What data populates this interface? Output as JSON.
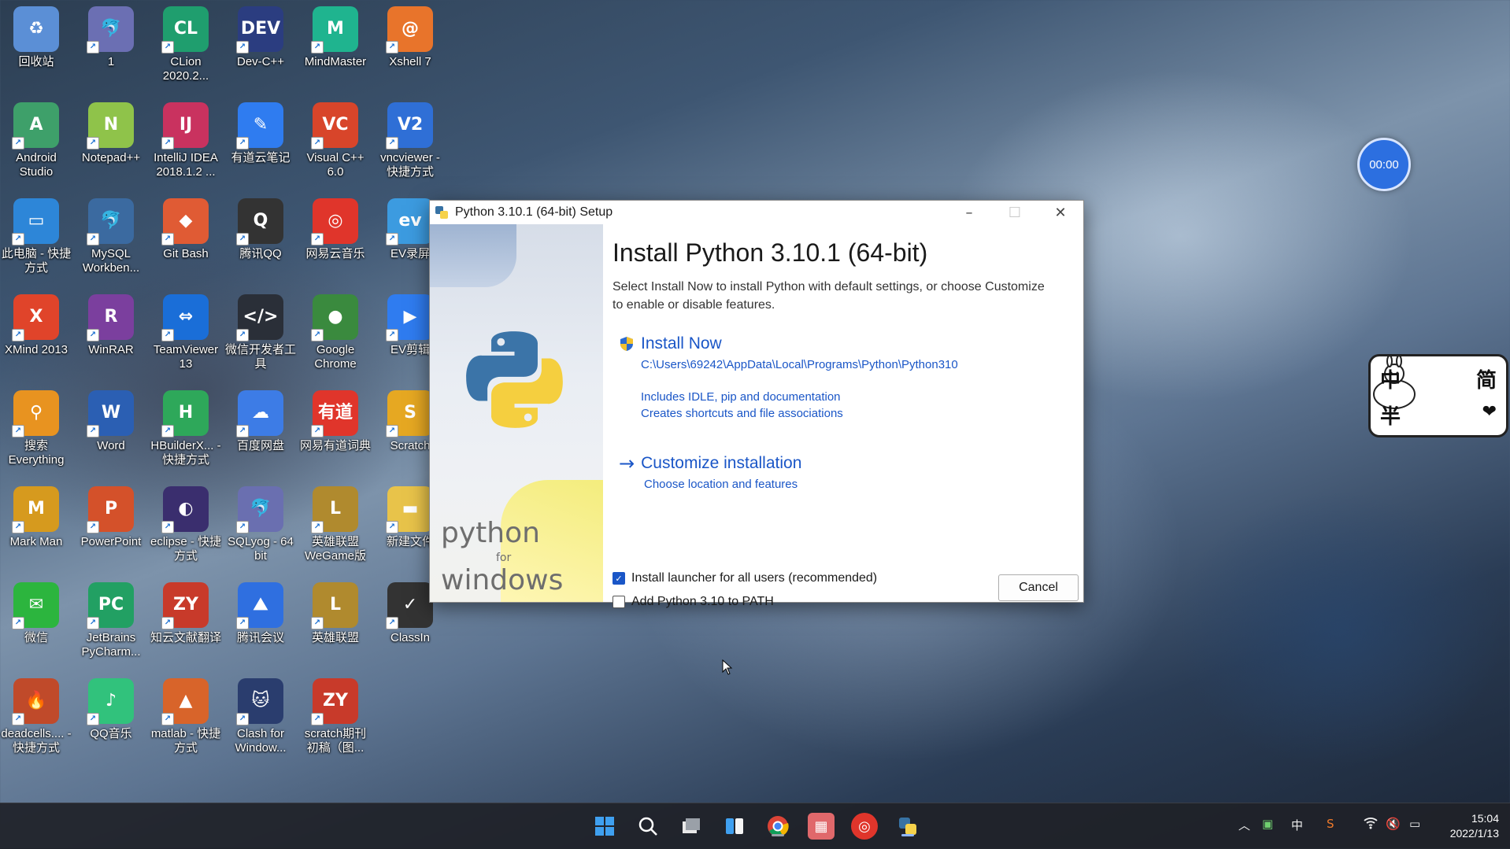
{
  "desktop_icons": [
    {
      "label": "回收站",
      "glyph": "♻",
      "color": "#5b8fd6"
    },
    {
      "label": "1",
      "glyph": "🐬",
      "color": "#6b6fb3"
    },
    {
      "label": "CLion 2020.2...",
      "glyph": "CL",
      "color": "#1f9e6e"
    },
    {
      "label": "Dev-C++",
      "glyph": "DEV",
      "color": "#2b3d80"
    },
    {
      "label": "MindMaster",
      "glyph": "M",
      "color": "#1fb48f"
    },
    {
      "label": "Xshell 7",
      "glyph": "@",
      "color": "#e8742b"
    },
    {
      "label": "Android Studio",
      "glyph": "A",
      "color": "#3ea06a"
    },
    {
      "label": "Notepad++",
      "glyph": "N",
      "color": "#8fc34a"
    },
    {
      "label": "IntelliJ IDEA 2018.1.2 ...",
      "glyph": "IJ",
      "color": "#c9325f"
    },
    {
      "label": "有道云笔记",
      "glyph": "✎",
      "color": "#2f7cf0"
    },
    {
      "label": "Visual C++ 6.0",
      "glyph": "VC",
      "color": "#d8452a"
    },
    {
      "label": "vncviewer - 快捷方式",
      "glyph": "V2",
      "color": "#2f6fd6"
    },
    {
      "label": "此电脑 - 快捷方式",
      "glyph": "▭",
      "color": "#2d86d8"
    },
    {
      "label": "MySQL Workben...",
      "glyph": "🐬",
      "color": "#3b6aa0"
    },
    {
      "label": "Git Bash",
      "glyph": "◆",
      "color": "#e05b34"
    },
    {
      "label": "腾讯QQ",
      "glyph": "Q",
      "color": "#333333"
    },
    {
      "label": "网易云音乐",
      "glyph": "◎",
      "color": "#e0352b"
    },
    {
      "label": "EV录屏",
      "glyph": "ev",
      "color": "#3c9be0"
    },
    {
      "label": "XMind 2013",
      "glyph": "X",
      "color": "#e0442a"
    },
    {
      "label": "WinRAR",
      "glyph": "R",
      "color": "#7b3f9e"
    },
    {
      "label": "TeamViewer 13",
      "glyph": "⇔",
      "color": "#1a6ed8"
    },
    {
      "label": "微信开发者工具",
      "glyph": "</>",
      "color": "#2a2f38"
    },
    {
      "label": "Google Chrome",
      "glyph": "●",
      "color": "#3a8a3e"
    },
    {
      "label": "EV剪辑",
      "glyph": "▶",
      "color": "#2f7cf0"
    },
    {
      "label": "搜索 Everything",
      "glyph": "⚲",
      "color": "#e89320"
    },
    {
      "label": "Word",
      "glyph": "W",
      "color": "#2b5fb3"
    },
    {
      "label": "HBuilderX... - 快捷方式",
      "glyph": "H",
      "color": "#2ea85a"
    },
    {
      "label": "百度网盘",
      "glyph": "☁",
      "color": "#3d7ce6"
    },
    {
      "label": "网易有道词典",
      "glyph": "有道",
      "color": "#e0352b"
    },
    {
      "label": "Scratch",
      "glyph": "S",
      "color": "#e6a822"
    },
    {
      "label": "Mark Man",
      "glyph": "M",
      "color": "#d69a1e"
    },
    {
      "label": "PowerPoint",
      "glyph": "P",
      "color": "#d4512a"
    },
    {
      "label": "eclipse - 快捷方式",
      "glyph": "◐",
      "color": "#3a2e6e"
    },
    {
      "label": "SQLyog - 64 bit",
      "glyph": "🐬",
      "color": "#6a6fb0"
    },
    {
      "label": "英雄联盟 WeGame版",
      "glyph": "L",
      "color": "#b08a2e"
    },
    {
      "label": "新建文件",
      "glyph": "▬",
      "color": "#e8c34a"
    },
    {
      "label": "微信",
      "glyph": "✉",
      "color": "#2cb53e"
    },
    {
      "label": "JetBrains PyCharm...",
      "glyph": "PC",
      "color": "#22a063"
    },
    {
      "label": "知云文献翻译",
      "glyph": "ZY",
      "color": "#c83a2a"
    },
    {
      "label": "腾讯会议",
      "glyph": "⛰",
      "color": "#2f6fe0"
    },
    {
      "label": "英雄联盟",
      "glyph": "L",
      "color": "#b08a2e"
    },
    {
      "label": "ClassIn",
      "glyph": "✓",
      "color": "#333333"
    },
    {
      "label": "deadcells.... - 快捷方式",
      "glyph": "🔥",
      "color": "#c04a2a"
    },
    {
      "label": "QQ音乐",
      "glyph": "♪",
      "color": "#31c27c"
    },
    {
      "label": "matlab - 快捷方式",
      "glyph": "▲",
      "color": "#d8642a"
    },
    {
      "label": "Clash for Window...",
      "glyph": "🐱",
      "color": "#2a3d6e"
    },
    {
      "label": "scratch期刊初稿（图...",
      "glyph": "ZY",
      "color": "#c83a2a"
    }
  ],
  "dialog": {
    "title": "Python 3.10.1 (64-bit) Setup",
    "heading": "Install Python 3.10.1 (64-bit)",
    "description": "Select Install Now to install Python with default settings, or choose Customize to enable or disable features.",
    "install_now": {
      "label": "Install Now",
      "path": "C:\\Users\\69242\\AppData\\Local\\Programs\\Python\\Python310",
      "detail1": "Includes IDLE, pip and documentation",
      "detail2": "Creates shortcuts and file associations"
    },
    "customize": {
      "label": "Customize installation",
      "detail": "Choose location and features"
    },
    "launcher_checkbox": {
      "label": "Install launcher for all users (recommended)",
      "checked": true
    },
    "path_checkbox": {
      "label": "Add Python 3.10 to PATH",
      "checked": false
    },
    "cancel_label": "Cancel",
    "side_text": {
      "python": "python",
      "for": "for",
      "windows": "windows"
    }
  },
  "timer": "00:00",
  "ime": {
    "k1": "中",
    "k2": "半",
    "k3": "简",
    "k4": "❤"
  },
  "taskbar": {
    "tray_lang": "中",
    "time": "15:04",
    "date": "2022/1/13"
  },
  "colors": {
    "accent": "#1a56c7",
    "taskbar": "#202228"
  }
}
